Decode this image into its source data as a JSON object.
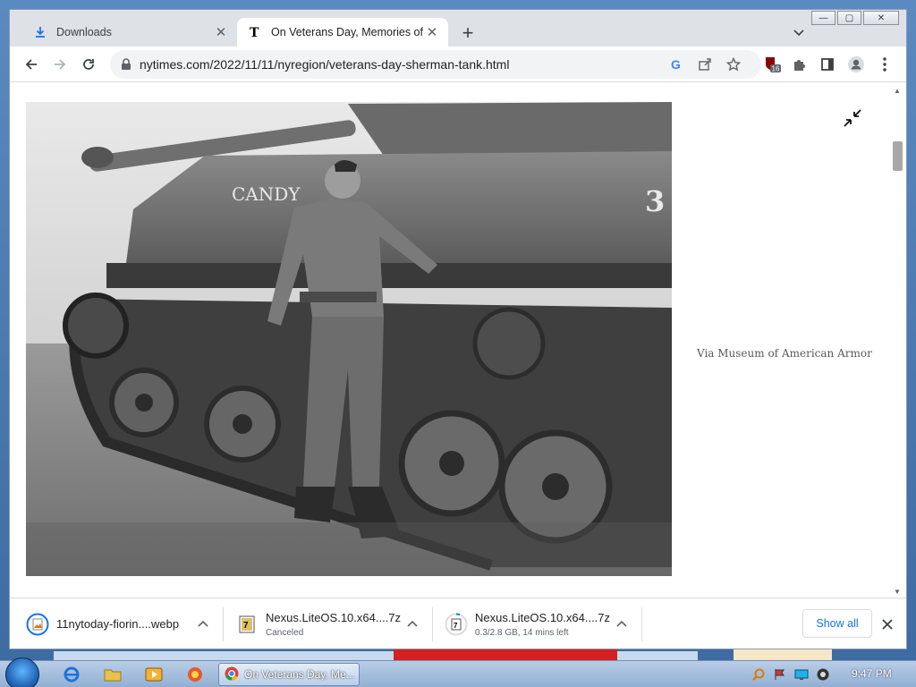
{
  "browser": {
    "tabs": [
      {
        "title": "Downloads",
        "icon": "download-icon",
        "active": false
      },
      {
        "title": "On Veterans Day, Memories of D",
        "icon": "nytimes-icon",
        "active": true
      }
    ],
    "url": "nytimes.com/2022/11/11/nyregion/veterans-day-sherman-tank.html",
    "extension_badge": "16",
    "window_buttons": {
      "minimize": "—",
      "maximize": "▢",
      "close": "✕"
    }
  },
  "page": {
    "image_text": {
      "tank_name": "CANDY",
      "tank_number": "3"
    },
    "caption": "Via Museum of American Armor"
  },
  "downloads": [
    {
      "name": "11nytoday-fiorin....webp",
      "status": ""
    },
    {
      "name": "Nexus.LiteOS.10.x64....7z",
      "status": "Canceled"
    },
    {
      "name": "Nexus.LiteOS.10.x64....7z",
      "status": "0.3/2.8 GB, 14 mins left"
    }
  ],
  "download_bar": {
    "show_all_label": "Show all"
  },
  "taskbar": {
    "task_label": "On Veterans Day, Me...",
    "clock": "9:47 PM"
  },
  "colors": {
    "accent": "#1a73e8",
    "tab_bg": "#dee1e6"
  }
}
